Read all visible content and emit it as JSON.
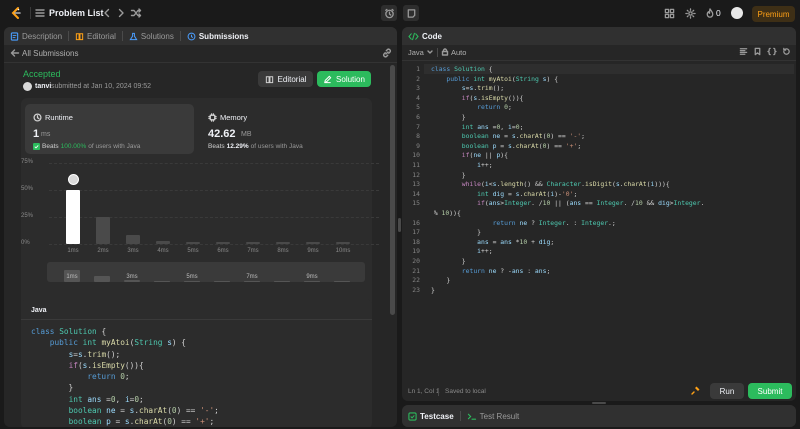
{
  "nav": {
    "problem_list": "Problem List",
    "streak_count": "0",
    "premium": "Premium"
  },
  "left_tabs": [
    {
      "label": "Description"
    },
    {
      "label": "Editorial"
    },
    {
      "label": "Solutions"
    },
    {
      "label": "Submissions"
    }
  ],
  "submission": {
    "back_label": "All Submissions",
    "status": "Accepted",
    "user": "tanvi",
    "submitted_text": "submitted at Jan 10, 2024 09:52",
    "editorial_btn": "Editorial",
    "solution_btn": "Solution",
    "runtime": {
      "label": "Runtime",
      "value": "1",
      "unit": "ms",
      "beats_prefix": "Beats",
      "beats_pct": "100.00%",
      "beats_suffix": "of users with Java"
    },
    "memory": {
      "label": "Memory",
      "value": "42.62",
      "unit": "MB",
      "beats_prefix": "Beats",
      "beats_pct": "12.29%",
      "beats_suffix": "of users with Java"
    },
    "code_lang": "Java"
  },
  "chart_data": {
    "type": "bar",
    "categories": [
      "1ms",
      "2ms",
      "3ms",
      "4ms",
      "5ms",
      "6ms",
      "7ms",
      "8ms",
      "9ms",
      "10ms"
    ],
    "values": [
      50,
      25,
      8,
      3,
      2,
      1.5,
      1.5,
      1.5,
      1.5,
      1.5
    ],
    "y_ticks": [
      "75%",
      "50%",
      "25%",
      "0%"
    ],
    "ylim": [
      0,
      75
    ],
    "highlight_index": 0,
    "mini_labels": [
      "1ms",
      "3ms",
      "5ms",
      "7ms",
      "9ms"
    ],
    "grid": true,
    "colors": {
      "highlight": "#ffffff",
      "bar": "#4a4a4a"
    }
  },
  "right_panel": {
    "code_tab": "Code",
    "language": "Java",
    "mode": "Auto",
    "status_pos": "Ln 1, Col 1",
    "status_saved": "Saved to local",
    "run_btn": "Run",
    "submit_btn": "Submit",
    "testcase_tab": "Testcase",
    "result_tab": "Test Result"
  },
  "code_lines": [
    "class Solution {",
    "    public int myAtoi(String s) {",
    "        s=s.trim();",
    "        if(s.isEmpty()){",
    "            return 0;",
    "        }",
    "        int ans =0, i=0;",
    "        boolean ne = s.charAt(0) == '-';",
    "        boolean p = s.charAt(0) == '+';",
    "        if(ne || p){",
    "            i++;",
    "        }",
    "        while(i<s.length() && Character.isDigit(s.charAt(i))){",
    "            int dig = s.charAt(i)-'0';",
    "            if(ans>Integer.MAX_VALUE /10 || (ans == Integer.MAX_VALUE /10 && dig>Integer.",
    "MAX_VALUE % 10)){",
    "                return ne ? Integer.MIN_VALUE : Integer.MAX_VALUE;",
    "            }",
    "            ans = ans *10 + dig;",
    "            i++;",
    "        }",
    "        return ne ? -ans : ans;",
    "    }",
    "}"
  ],
  "line_numbers": [
    "1",
    "2",
    "3",
    "4",
    "5",
    "6",
    "7",
    "8",
    "9",
    "10",
    "11",
    "12",
    "13",
    "14",
    "15",
    "",
    "16",
    "17",
    "18",
    "19",
    "20",
    "21",
    "22",
    "23"
  ]
}
